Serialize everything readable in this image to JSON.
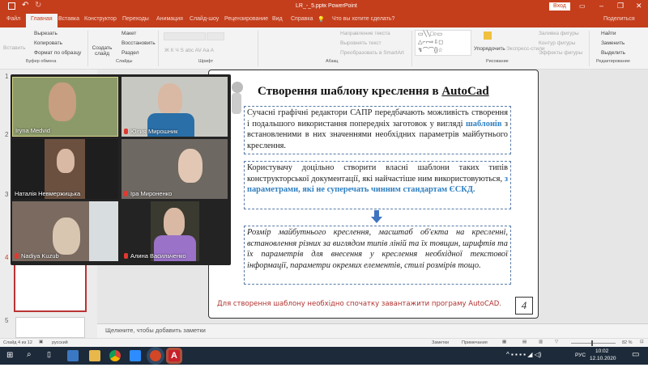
{
  "titlebar": {
    "filename": "LR_-_5.pptx",
    "app": "PowerPoint",
    "signin": "Вход"
  },
  "tabs": [
    "Файл",
    "Главная",
    "Вставка",
    "Конструктор",
    "Переходы",
    "Анимация",
    "Слайд-шоу",
    "Рецензирование",
    "Вид",
    "Справка"
  ],
  "tellme": "Что вы хотите сделать?",
  "share": "Поделиться",
  "ribbon": {
    "paste": "Вставить",
    "cut": "Вырезать",
    "copy": "Копировать",
    "format_painter": "Формат по образцу",
    "clipboard_group": "Буфер обмена",
    "new_slide": "Создать слайд",
    "layout": "Макет",
    "reset": "Восстановить",
    "section": "Раздел",
    "slides_group": "Слайды",
    "font_group": "Шрифт",
    "text_direction": "Направление текста",
    "align_text": "Выровнять текст",
    "smartart": "Преобразовать в SmartArt",
    "paragraph_group": "Абзац",
    "arrange": "Упорядочить",
    "quick_styles": "Экспресс-стили",
    "shape_fill": "Заливка фигуры",
    "shape_outline": "Контур фигуры",
    "shape_effects": "Эффекты фигуры",
    "drawing_group": "Рисование",
    "find": "Найти",
    "replace": "Заменить",
    "select": "Выделить",
    "editing_group": "Редактирование"
  },
  "thumbnails": [
    "1",
    "2",
    "3",
    "4",
    "5"
  ],
  "zoom": {
    "participants": [
      {
        "name": "Iryna Medvid",
        "muted": false
      },
      {
        "name": "Юлия Мирошник",
        "muted": true
      },
      {
        "name": "Наталія Невмержицька",
        "muted": false
      },
      {
        "name": "Іра Мироненко",
        "muted": true
      },
      {
        "name": "Nadiya Kuzub",
        "muted": true
      },
      {
        "name": "Алина Васильченко",
        "muted": true
      }
    ]
  },
  "slide": {
    "title_a": "Створення шаблону креслення в ",
    "title_b": "AutoCad",
    "box1_a": "Сучасні графічні редактори САПР передбачають можливість створення і подальшого використання попередніх заготовок у вигляді ",
    "box1_b": "шаблонів",
    "box1_c": " з встановленими в них значеннями необхідних параметрів майбутнього креслення.",
    "box2_a": "Користувачу доцільно створити власні шаблони таких типів конструкторської документації, які найчастіше ним використовуються, ",
    "box2_b": "з параметрами, які не суперечать чинним стандартам ЄСКД.",
    "box3": "Розмір майбутнього креслення, масштаб об'єкта на кресленні, встановлення різних за виглядом типів ліній та їх товщин, шрифтів та їх параметрів для внесення у креслення необхідної текстової інформації, параметри окремих елементів, стилі розмірів тощо.",
    "footnote": "Для створення шаблону необхідно спочатку завантажити програму AutoCAD.",
    "page_number": "4"
  },
  "notes_placeholder": "Щелкните, чтобы добавить заметки",
  "status": {
    "slide": "Слайд 4 из 12",
    "language": "русский",
    "notes": "Заметки",
    "comments": "Примечания",
    "zoom": "82 %",
    "zoom_level": 0.45
  },
  "taskbar": {
    "lang": "РУС",
    "time": "10:02",
    "date": "12.10.2020"
  },
  "colors": {
    "accent": "#c43e1c",
    "blue": "#2f7fc1",
    "footnote": "#b0312e"
  }
}
